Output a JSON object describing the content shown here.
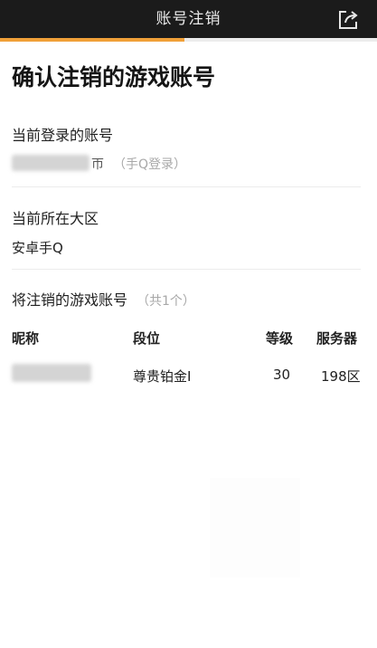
{
  "header": {
    "title": "账号注销",
    "share_icon": "share-out-icon"
  },
  "progress": {
    "fraction": 0.49,
    "color": "#f0a038"
  },
  "page": {
    "title": "确认注销的游戏账号"
  },
  "current_account": {
    "label": "当前登录的账号",
    "partial_value": "帀",
    "login_type": "（手Q登录）"
  },
  "current_region": {
    "label": "当前所在大区",
    "value": "安卓手Q"
  },
  "accounts_to_cancel": {
    "label": "将注销的游戏账号",
    "count": "（共1个）",
    "columns": [
      "昵称",
      "段位",
      "等级",
      "服务器"
    ],
    "rows": [
      {
        "nickname": "",
        "rank": "尊贵铂金I",
        "level": "30",
        "server": "198区"
      }
    ]
  }
}
